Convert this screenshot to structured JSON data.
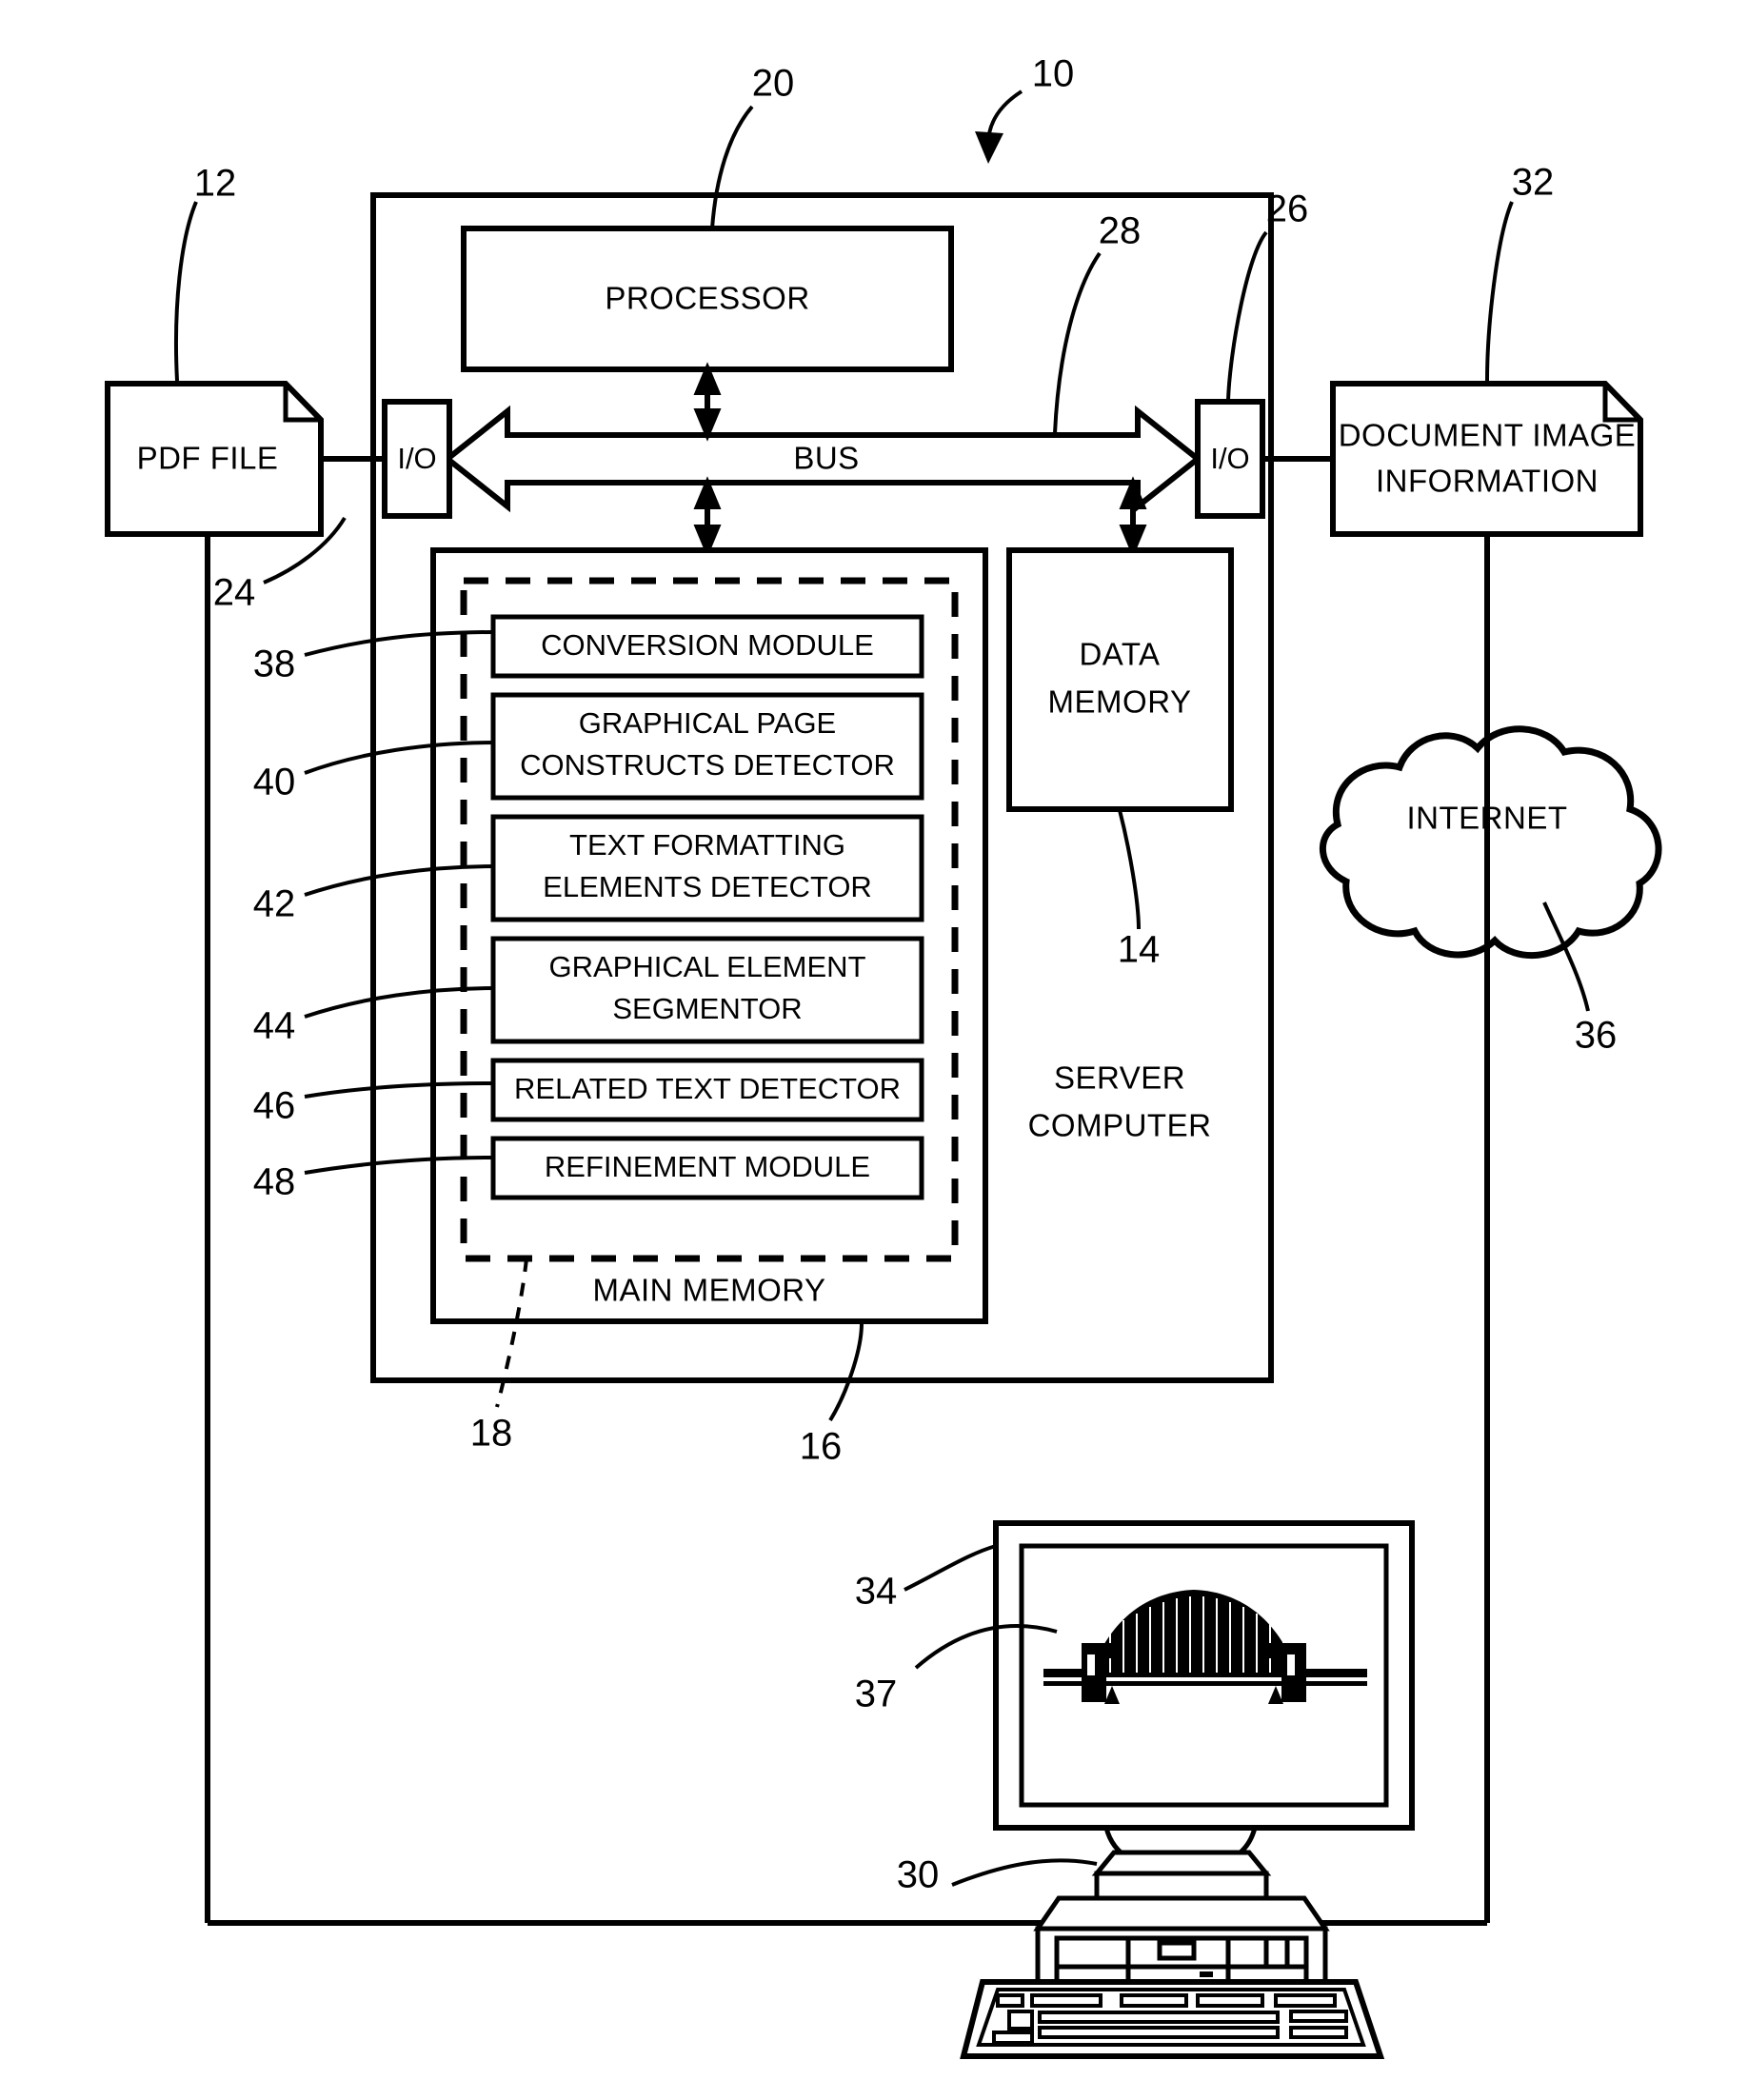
{
  "figure": {
    "domain": "patent-block-diagram",
    "title": "System block diagram with server computer, PDF file input and document image information output"
  },
  "nodes": {
    "pdf_file": {
      "label": "PDF FILE",
      "ref": "12"
    },
    "io_left": {
      "label": "I/O",
      "ref": "24"
    },
    "processor": {
      "label": "PROCESSOR",
      "ref": "20"
    },
    "bus": {
      "label": "BUS",
      "ref": "28"
    },
    "io_right": {
      "label": "I/O",
      "ref": "26"
    },
    "document_image_information": {
      "label_line1": "DOCUMENT  IMAGE",
      "label_line2": "INFORMATION",
      "ref": "32"
    },
    "data_memory": {
      "label_line1": "DATA",
      "label_line2": "MEMORY",
      "ref": "14"
    },
    "internet": {
      "label": "INTERNET",
      "ref": "36"
    },
    "server_computer": {
      "label_line1": "SERVER",
      "label_line2": "COMPUTER",
      "ref": "10"
    },
    "main_memory": {
      "label": "MAIN MEMORY",
      "ref": "16"
    },
    "program_memory_dashed": {
      "ref": "18"
    },
    "workstation": {
      "ref": "30"
    },
    "monitor": {
      "ref": "34"
    },
    "displayed_image": {
      "ref": "37",
      "description": "arch bridge graphic"
    }
  },
  "modules": [
    {
      "ref": "38",
      "label_line1": "CONVERSION MODULE",
      "label_line2": ""
    },
    {
      "ref": "40",
      "label_line1": "GRAPHICAL PAGE",
      "label_line2": "CONSTRUCTS DETECTOR"
    },
    {
      "ref": "42",
      "label_line1": "TEXT FORMATTING",
      "label_line2": "ELEMENTS DETECTOR"
    },
    {
      "ref": "44",
      "label_line1": "GRAPHICAL ELEMENT",
      "label_line2": "SEGMENTOR"
    },
    {
      "ref": "46",
      "label_line1": "RELATED TEXT DETECTOR",
      "label_line2": ""
    },
    {
      "ref": "48",
      "label_line1": "REFINEMENT MODULE",
      "label_line2": ""
    }
  ],
  "reference_numerals": [
    "10",
    "12",
    "14",
    "16",
    "18",
    "20",
    "24",
    "26",
    "28",
    "30",
    "32",
    "34",
    "36",
    "37",
    "38",
    "40",
    "42",
    "44",
    "46",
    "48"
  ],
  "colors": {
    "ink": "#000000",
    "paper": "#ffffff"
  }
}
